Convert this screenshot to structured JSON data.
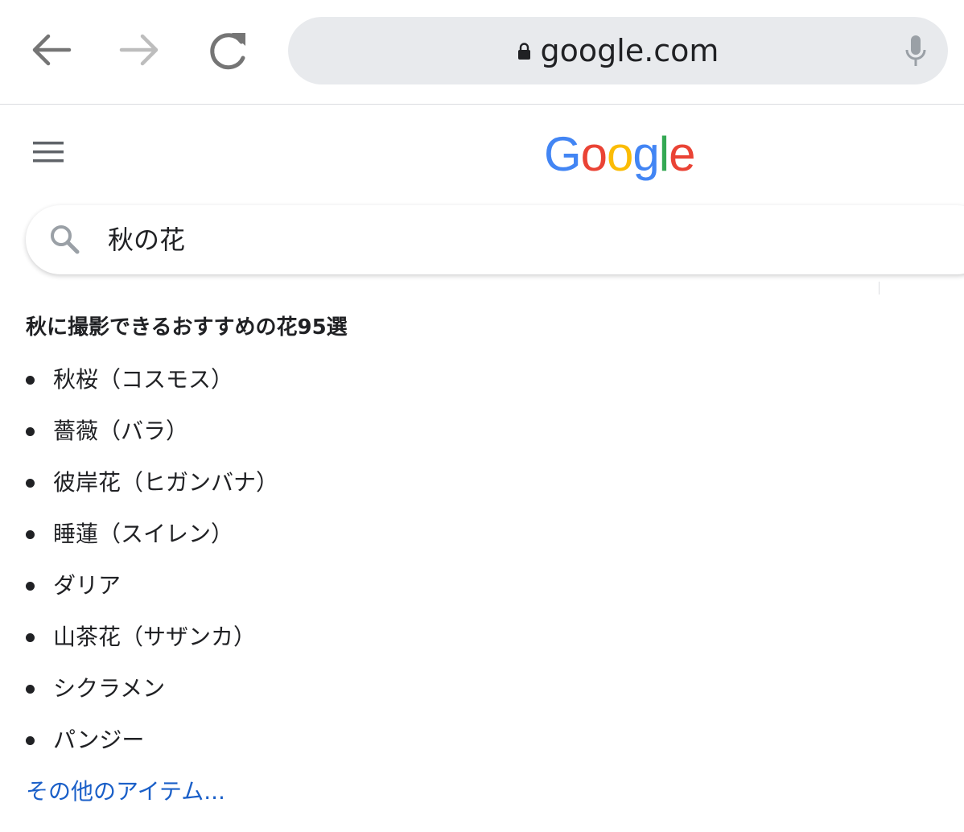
{
  "browser": {
    "url": "google.com",
    "icons": {
      "back": "arrow-left-icon",
      "forward": "arrow-right-icon",
      "reload": "reload-icon",
      "lock": "lock-icon",
      "mic": "microphone-icon"
    }
  },
  "header": {
    "menu_icon": "hamburger-menu-icon",
    "logo": {
      "letters": [
        "G",
        "o",
        "o",
        "g",
        "l",
        "e"
      ],
      "colors": [
        "#4285F4",
        "#EA4335",
        "#FBBC05",
        "#4285F4",
        "#34A853",
        "#EA4335"
      ]
    }
  },
  "search": {
    "query": "秋の花",
    "icon": "search-icon"
  },
  "snippet": {
    "title": "秋に撮影できるおすすめの花95選",
    "items": [
      "秋桜（コスモス）",
      "薔薇（バラ）",
      "彼岸花（ヒガンバナ）",
      "睡蓮（スイレン）",
      "ダリア",
      "山茶花（サザンカ）",
      "シクラメン",
      "パンジー"
    ],
    "more_link": "その他のアイテム..."
  },
  "colors": {
    "link": "#1a5fc8",
    "text": "#202124",
    "omnibox_bg": "#e8eaed",
    "icon_gray": "#757575",
    "icon_disabled": "#bdbdbd"
  }
}
